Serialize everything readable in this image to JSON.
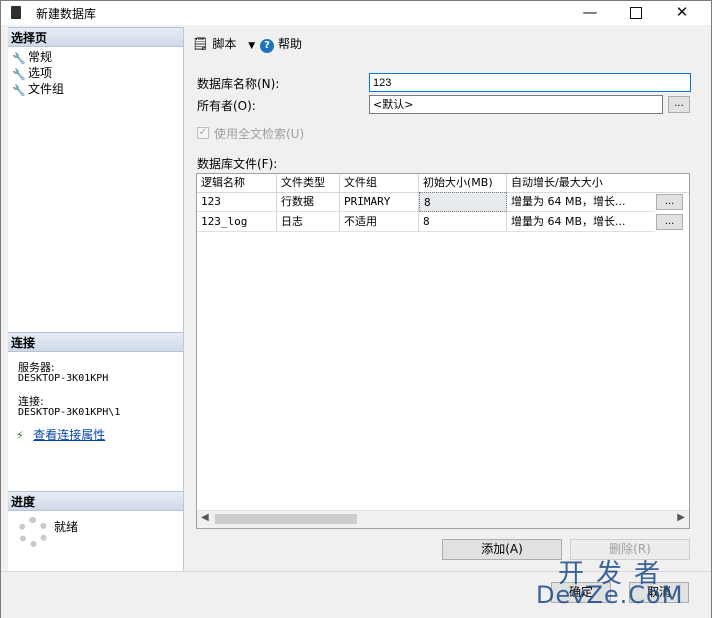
{
  "window": {
    "title": "新建数据库",
    "minimize": "—",
    "close": "✕"
  },
  "left": {
    "select_page_header": "选择页",
    "pages": [
      "常规",
      "选项",
      "文件组"
    ],
    "connection_header": "连接",
    "server_label": "服务器:",
    "server_value": "DESKTOP-3K01KPH",
    "connection_label": "连接:",
    "connection_value": "DESKTOP-3K01KPH\\1",
    "view_props_link": "查看连接属性",
    "progress_header": "进度",
    "progress_status": "就绪"
  },
  "toolbar": {
    "script_label": "脚本",
    "help_label": "帮助"
  },
  "form": {
    "db_name_label": "数据库名称(N):",
    "db_name_value": "123",
    "owner_label": "所有者(O):",
    "owner_value": "<默认>",
    "owner_browse": "...",
    "fulltext_label": "使用全文检索(U)",
    "fulltext_checked": true,
    "files_label": "数据库文件(F):"
  },
  "grid": {
    "columns": [
      "逻辑名称",
      "文件类型",
      "文件组",
      "初始大小(MB)",
      "自动增长/最大大小"
    ],
    "rows": [
      {
        "name": "123",
        "type": "行数据",
        "filegroup": "PRIMARY",
        "size": "8",
        "growth": "增量为 64 MB，增长...",
        "btn": "..."
      },
      {
        "name": "123_log",
        "type": "日志",
        "filegroup": "不适用",
        "size": "8",
        "growth": "增量为 64 MB，增长...",
        "btn": "..."
      }
    ]
  },
  "buttons": {
    "add": "添加(A)",
    "remove": "删除(R)",
    "ok": "确定",
    "cancel": "取消"
  },
  "watermark": {
    "line1": "开发者",
    "line2": "DevZe.CoM"
  }
}
